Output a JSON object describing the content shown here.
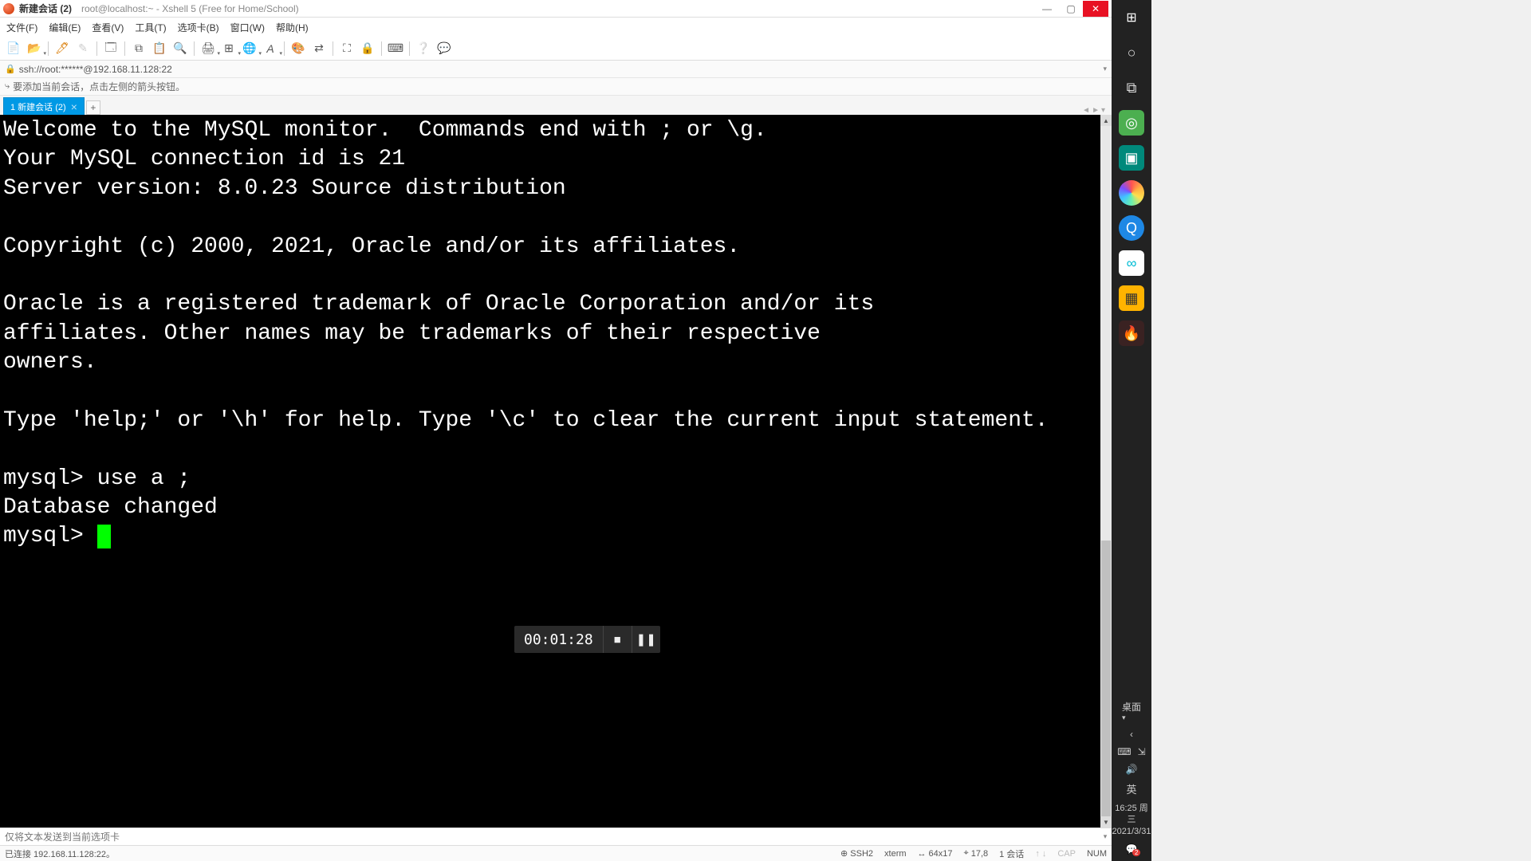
{
  "title": {
    "main": "新建会话 (2)",
    "sub": "root@localhost:~ - Xshell 5 (Free for Home/School)"
  },
  "menus": [
    "文件(F)",
    "编辑(E)",
    "查看(V)",
    "工具(T)",
    "选项卡(B)",
    "窗口(W)",
    "帮助(H)"
  ],
  "address": "ssh://root:******@192.168.11.128:22",
  "hint": "要添加当前会话，点击左侧的箭头按钮。",
  "tabs": {
    "active": "1 新建会话 (2)"
  },
  "terminal": {
    "lines": [
      "Welcome to the MySQL monitor.  Commands end with ; or \\g.",
      "Your MySQL connection id is 21",
      "Server version: 8.0.23 Source distribution",
      "",
      "Copyright (c) 2000, 2021, Oracle and/or its affiliates.",
      "",
      "Oracle is a registered trademark of Oracle Corporation and/or its",
      "affiliates. Other names may be trademarks of their respective",
      "owners.",
      "",
      "Type 'help;' or '\\h' for help. Type '\\c' to clear the current input statement.",
      "",
      "mysql> use a ;",
      "Database changed",
      "mysql> "
    ]
  },
  "send_placeholder": "仅将文本发送到当前选项卡",
  "status": {
    "left": "已连接 192.168.11.128:22。",
    "proto": "SSH2",
    "term": "xterm",
    "size": "64x17",
    "pos": "17,8",
    "sessions": "1 会话",
    "cap": "CAP",
    "num": "NUM"
  },
  "media": {
    "time": "00:01:28"
  },
  "systray": {
    "desktop_label": "桌面",
    "lang": "英",
    "time": "16:25 周三",
    "date": "2021/3/31",
    "notif_count": "2"
  }
}
